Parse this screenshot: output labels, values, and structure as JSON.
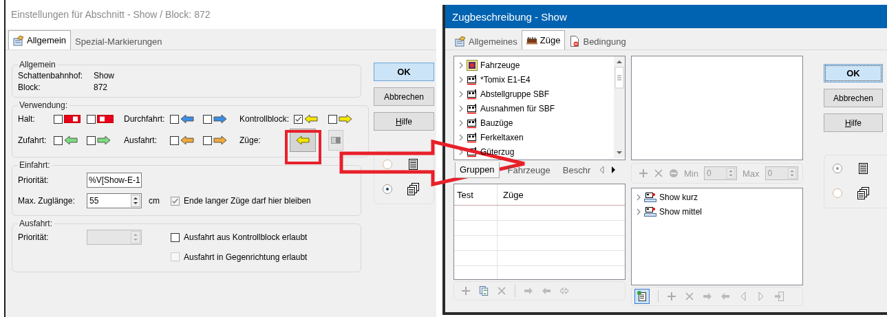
{
  "settings_dialog": {
    "title": "Einstellungen für Abschnitt - Show / Block: 872",
    "tabs": [
      {
        "label": "Allgemein",
        "selected": true
      },
      {
        "label": "Spezial-Markierungen",
        "selected": false
      }
    ],
    "general": {
      "legend": "Allgemein",
      "rows": [
        {
          "label": "Schattenbahnhof:",
          "value": "Show"
        },
        {
          "label": "Block:",
          "value": "872"
        }
      ]
    },
    "usage": {
      "legend": "Verwendung:",
      "groups": [
        {
          "label": "Halt:",
          "options": [
            {
              "kind": "stop-left",
              "checked": false,
              "color": "#e8001c"
            },
            {
              "kind": "stop-right",
              "checked": false,
              "color": "#e8001c"
            }
          ]
        },
        {
          "label": "Durchfahrt:",
          "options": [
            {
              "kind": "arrow-left",
              "checked": false,
              "color": "#3a8ee6"
            },
            {
              "kind": "arrow-right",
              "checked": false,
              "color": "#3a8ee6"
            }
          ]
        },
        {
          "label": "Kontrollblock:",
          "options": [
            {
              "kind": "arrow-left",
              "checked": true,
              "color": "#f5e600"
            },
            {
              "kind": "arrow-right",
              "checked": false,
              "color": "#f5e600"
            }
          ]
        },
        {
          "label": "Zufahrt:",
          "options": [
            {
              "kind": "arrow-left",
              "checked": false,
              "color": "#7ddc7d"
            },
            {
              "kind": "arrow-right",
              "checked": false,
              "color": "#7ddc7d"
            }
          ]
        },
        {
          "label": "Ausfahrt:",
          "options": [
            {
              "kind": "arrow-left",
              "checked": false,
              "color": "#f2a93b"
            },
            {
              "kind": "arrow-right",
              "checked": false,
              "color": "#f2a93b"
            }
          ]
        },
        {
          "label": "Züge:",
          "options": [
            {
              "kind": "toggle-arrow",
              "checked": true,
              "color": "#f5e600"
            },
            {
              "kind": "toggle-switch",
              "checked": false
            }
          ]
        }
      ]
    },
    "entry": {
      "legend": "Einfahrt:",
      "priority_label": "Priorität:",
      "priority_value": "%V[Show-E-1",
      "length_label": "Max. Zuglänge:",
      "length_value": "55",
      "unit": "cm",
      "long_trains": {
        "label": "Ende langer Züge darf hier bleiben",
        "checked": true
      }
    },
    "exit": {
      "legend": "Ausfahrt:",
      "priority_label": "Priorität:",
      "priority_disabled": true,
      "checkboxes": [
        {
          "label": "Ausfahrt aus Kontrollblock erlaubt",
          "checked": false,
          "disabled": false
        },
        {
          "label": "Ausfahrt in Gegenrichtung erlaubt",
          "checked": false,
          "disabled": true
        }
      ]
    },
    "buttons": [
      {
        "label": "OK",
        "default": true,
        "underline_first": false
      },
      {
        "label": "Abbrechen",
        "default": false,
        "underline_first": false
      },
      {
        "label": "Hilfe",
        "default": false,
        "underline_first": true
      }
    ],
    "view_options": [
      {
        "kind": "list",
        "selected": false
      },
      {
        "kind": "pages",
        "selected": true
      }
    ]
  },
  "train_dialog": {
    "title": "Zugbeschreibung - Show",
    "tabs": [
      {
        "label": "Allgemeines",
        "selected": false,
        "kind": "settings"
      },
      {
        "label": "Züge",
        "selected": true,
        "kind": "train"
      },
      {
        "label": "Bedingung",
        "selected": false,
        "kind": "condition"
      }
    ],
    "groups_tree": [
      {
        "label": "Fahrzeuge",
        "kind": "vehicles",
        "expanded": false
      },
      {
        "label": "*Tomix E1-E4",
        "kind": "group",
        "expanded": false
      },
      {
        "label": "Abstellgruppe SBF",
        "kind": "group",
        "expanded": false
      },
      {
        "label": "Ausnahmen für SBF",
        "kind": "group",
        "expanded": false
      },
      {
        "label": "Bauzüge",
        "kind": "group",
        "expanded": false
      },
      {
        "label": "Ferkeltaxen",
        "kind": "group",
        "expanded": false
      },
      {
        "label": "Güterzug",
        "kind": "group",
        "expanded": false
      }
    ],
    "bottom_tabs": [
      {
        "label": "Gruppen",
        "selected": true
      },
      {
        "label": "Fahrzeuge",
        "selected": false
      },
      {
        "label": "Beschr",
        "selected": false
      }
    ],
    "filter": {
      "min_label": "Min",
      "min_value": "0",
      "max_label": "Max",
      "max_value": "0"
    },
    "table": {
      "columns": [
        "Test",
        "Züge"
      ]
    },
    "trains_tree": [
      {
        "label": "Show kurz",
        "expanded": false
      },
      {
        "label": "Show mittel",
        "expanded": false
      }
    ],
    "buttons": [
      {
        "label": "OK",
        "default": true,
        "underline_first": false
      },
      {
        "label": "Abbrechen",
        "default": false,
        "underline_first": false
      },
      {
        "label": "Hilfe",
        "default": false,
        "underline_first": true
      }
    ],
    "view_options": [
      {
        "kind": "list",
        "selected": true
      },
      {
        "kind": "pages",
        "selected": false
      }
    ]
  }
}
